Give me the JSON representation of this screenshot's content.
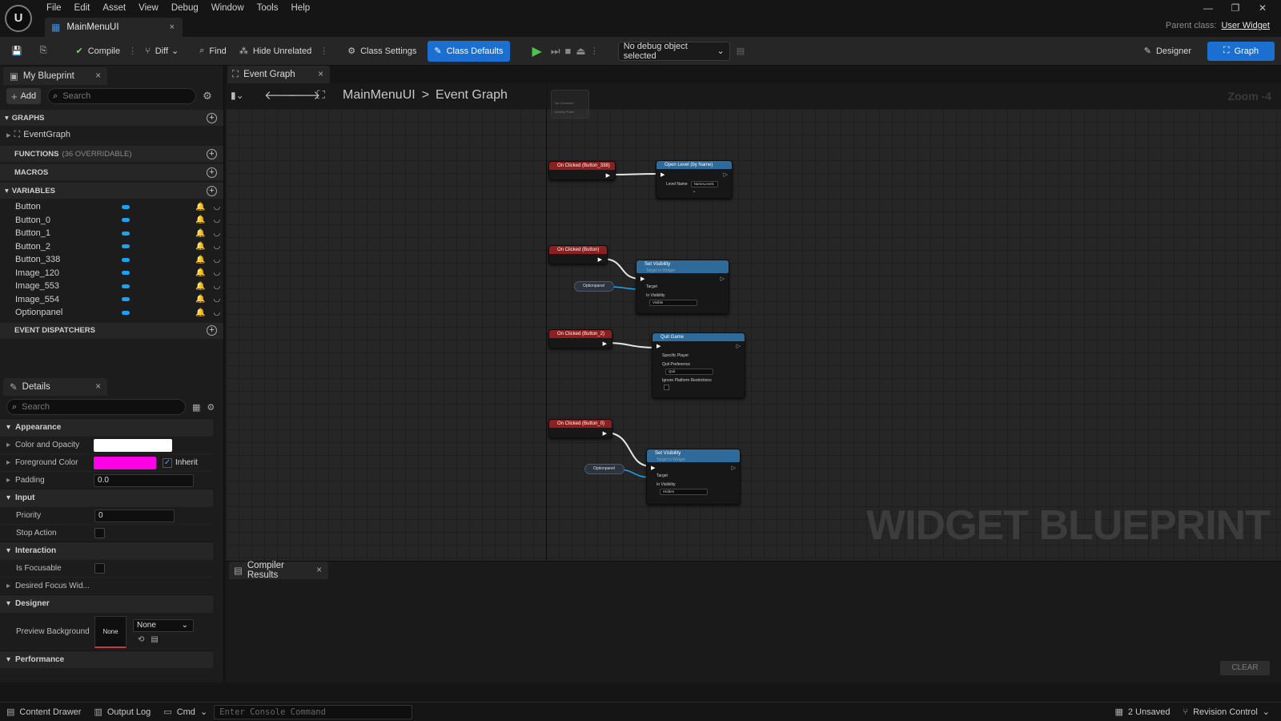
{
  "menu": [
    "File",
    "Edit",
    "Asset",
    "View",
    "Debug",
    "Window",
    "Tools",
    "Help"
  ],
  "logo": "U",
  "document_tab": {
    "label": "MainMenuUI",
    "close": "×"
  },
  "window_controls": {
    "minimize": "—",
    "restore": "❐",
    "close": "✕"
  },
  "parent_class": {
    "label": "Parent class:",
    "value": "User Widget"
  },
  "toolbar": {
    "compile": "Compile",
    "diff": "Diff",
    "find": "Find",
    "hide_unrelated": "Hide Unrelated",
    "class_settings": "Class Settings",
    "class_defaults": "Class Defaults",
    "debug_object": "No debug object selected",
    "designer": "Designer",
    "graph": "Graph"
  },
  "my_blueprint": {
    "tab": "My Blueprint",
    "add": "Add",
    "search_placeholder": "Search",
    "sections": {
      "graphs": "GRAPHS",
      "functions": "FUNCTIONS",
      "functions_sub": "(36 OVERRIDABLE)",
      "macros": "MACROS",
      "variables": "VARIABLES",
      "event_dispatchers": "EVENT DISPATCHERS"
    },
    "graph_items": [
      "EventGraph"
    ],
    "variables": [
      "Button",
      "Button_0",
      "Button_1",
      "Button_2",
      "Button_338",
      "Image_120",
      "Image_553",
      "Image_554",
      "Optionpanel"
    ]
  },
  "details": {
    "tab": "Details",
    "search_placeholder": "Search",
    "appearance": "Appearance",
    "color_and_opacity": "Color and Opacity",
    "foreground_color": "Foreground Color",
    "inherit": "Inherit",
    "padding": "Padding",
    "padding_value": "0.0",
    "input": "Input",
    "priority": "Priority",
    "priority_value": "0",
    "stop_action": "Stop Action",
    "interaction": "Interaction",
    "is_focusable": "Is Focusable",
    "desired_focus": "Desired Focus Wid...",
    "designer": "Designer",
    "preview_background": "Preview Background",
    "preview_swatch": "None",
    "preview_select": "None",
    "performance": "Performance",
    "colors": {
      "color_and_opacity": "#ffffff",
      "foreground": "#ff00e6"
    }
  },
  "graph": {
    "tab": "Event Graph",
    "breadcrumb_root": "MainMenuUI",
    "breadcrumb_sep": ">",
    "breadcrumb_leaf": "Event Graph",
    "zoom": "Zoom -4",
    "watermark": "WIDGET BLUEPRINT",
    "comment_lines": [
      "No Comment",
      "Activity Pulse"
    ],
    "nodes": {
      "ev1": "On Clicked (Button_338)",
      "fn1": "Open Level (by Name)",
      "fn1_pin": "Level Name",
      "fn1_value": "NameLevel1",
      "ev2": "On Clicked (Button)",
      "fn2": "Set Visibility",
      "fn2_sub": "Target is Widget",
      "fn2_target": "Target",
      "fn2_invis": "In Visibility",
      "fn2_value": "Visible",
      "var2": "Optionpanel",
      "ev3": "On Clicked (Button_2)",
      "fn3": "Quit Game",
      "fn3_p1": "Specific Player",
      "fn3_p2": "Quit Preference",
      "fn3_value": "Quit",
      "fn3_p3": "Ignore Platform Restrictions",
      "ev4": "On Clicked (Button_0)",
      "fn4": "Set Visibility",
      "fn4_sub": "Target is Widget",
      "fn4_target": "Target",
      "fn4_invis": "In Visibility",
      "fn4_value": "Hidden",
      "var4": "Optionpanel"
    }
  },
  "compiler": {
    "tab": "Compiler Results",
    "clear": "CLEAR"
  },
  "statusbar": {
    "content_drawer": "Content Drawer",
    "output_log": "Output Log",
    "cmd": "Cmd",
    "console_placeholder": "Enter Console Command",
    "unsaved": "2 Unsaved",
    "revision_control": "Revision Control"
  },
  "colors": {
    "accent": "#1a6fd1",
    "variable_pill": "#1da1f2",
    "event_header": "#8c1f1f",
    "function_header": "#2e6a9a"
  }
}
